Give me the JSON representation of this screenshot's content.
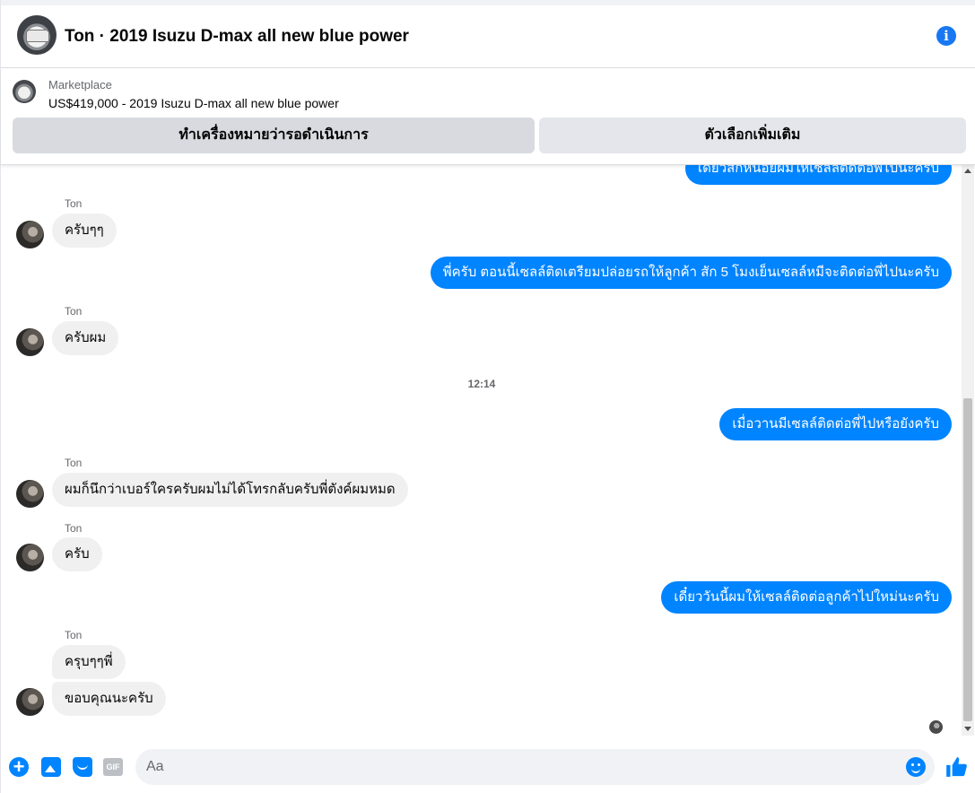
{
  "header": {
    "title": "Ton · 2019 Isuzu D-max all new blue power",
    "info_icon": "i"
  },
  "marketplace": {
    "label": "Marketplace",
    "listing": "US$419,000 - 2019 Isuzu D-max all new blue power",
    "buttons": {
      "mark_pending": "ทำเครื่องหมายว่ารอดำเนินการ",
      "more_options": "ตัวเลือกเพิ่มเติม"
    }
  },
  "messages": {
    "partial_top": "เดี๋ยวสักหน่อยผมให้เซลล์ติดต่อพี่ไปนะครับ",
    "items": [
      {
        "sender": "Ton",
        "text": "ครับๆๆ"
      },
      {
        "text": "พี่ครับ ตอนนี้เซลล์ติดเตรียมปล่อยรถให้ลูกค้า สัก 5 โมงเย็นเซลล์หมีจะติดต่อพี่ไปนะครับ"
      },
      {
        "sender": "Ton",
        "text": "ครับผม"
      },
      {
        "timestamp": "12:14"
      },
      {
        "text": "เมื่อวานมีเซลล์ติดต่อพี่ไปหรือยังครับ"
      },
      {
        "sender": "Ton",
        "text": "ผมก็นึกว่าเบอร์ใครครับผมไม่ได้โทรกลับครับพี่ตังค์ผมหมด"
      },
      {
        "sender": "Ton",
        "text": "ครับ"
      },
      {
        "text": "เดี๋ยววันนี้ผมให้เซลล์ติดต่อลูกค้าไปใหม่นะครับ"
      },
      {
        "sender": "Ton",
        "text": "ครุบๆๆพี่"
      },
      {
        "text": "ขอบคุณนะครับ"
      }
    ]
  },
  "composer": {
    "placeholder": "Aa",
    "gif_label": "GIF",
    "plus_label": "+"
  },
  "icons": {
    "plus": "plus-icon",
    "photo": "photo-icon",
    "sticker": "sticker-icon",
    "gif": "gif-icon",
    "emoji": "emoji-icon",
    "like": "thumbs-up-icon",
    "info": "info-icon"
  },
  "colors": {
    "accent": "#0084ff",
    "outgoing_bubble": "#0084ff",
    "incoming_bubble": "#f0f0f0",
    "button_bg": "#e4e6eb"
  }
}
